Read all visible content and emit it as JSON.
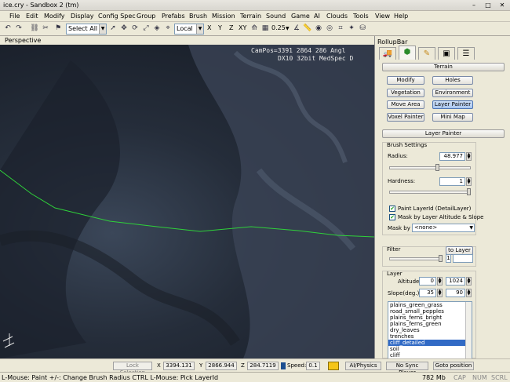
{
  "window": {
    "title": "ice.cry - Sandbox 2 (tm)"
  },
  "menu": [
    "File",
    "Edit",
    "Modify",
    "Display",
    "Config Spec",
    "Group",
    "Prefabs",
    "Brush",
    "Mission",
    "Terrain",
    "Sound",
    "Game",
    "AI",
    "Clouds",
    "Tools",
    "View",
    "Help"
  ],
  "toolbar": {
    "selection_filter": "Select All",
    "coord_system": "Local",
    "axes": [
      "X",
      "Y",
      "Z",
      "XY"
    ],
    "snap_value": "0.25"
  },
  "viewport": {
    "title": "Perspective",
    "hud_line1": "CamPos=3391 2864 286 Angl",
    "hud_line2": "DX10 32bit MedSpec D"
  },
  "rollup": {
    "title": "RollupBar",
    "terrain_header": "Terrain",
    "terrain_buttons": [
      "Modify",
      "Holes",
      "Vegetation",
      "Environment",
      "Move Area",
      "Layer Painter",
      "Voxel Painter",
      "Mini Map"
    ],
    "active_button": "Layer Painter",
    "layer_painter_header": "Layer Painter",
    "brush_settings": {
      "title": "Brush Settings",
      "radius_label": "Radius:",
      "radius_value": "48.977",
      "hardness_label": "Hardness:",
      "hardness_value": "1",
      "paint_layer_label": "Paint LayerId (DetailLayer)",
      "mask_label": "Mask by Layer Altitude & Slope",
      "mask_by_label": "Mask by",
      "mask_by_value": "<none>"
    },
    "filter": {
      "title": "Filter",
      "to_layer": "to Layer",
      "value": "1"
    },
    "layer": {
      "title": "Layer",
      "altitude_label": "Altitude",
      "altitude_min": "0",
      "altitude_max": "1024",
      "slope_label": "Slope(deg.)",
      "slope_min": "35",
      "slope_max": "90",
      "items": [
        "plains_green_grass",
        "road_small_pepples",
        "plains_ferns_bright",
        "plains_ferns_green",
        "dry_leaves",
        "trenches",
        "cliff_detailed",
        "soil",
        "cliff"
      ],
      "selected": "cliff_detailed"
    }
  },
  "bottombar": {
    "lock_selection": "Lock Selection",
    "x_label": "X",
    "x_value": "3394.131",
    "y_label": "Y",
    "y_value": "2866.944",
    "z_label": "Z",
    "z_value": "284.7119",
    "speed_label": "Speed:",
    "speed_value": "0.1",
    "ai_physics": "AI/Physics",
    "no_sync": "No Sync Player",
    "goto": "Goto position"
  },
  "statusbar": {
    "hint": "L-Mouse: Paint  +/-: Change Brush Radius   CTRL L-Mouse: Pick LayerId",
    "memory": "782 Mb",
    "indicators": [
      "CAP",
      "NUM",
      "SCRL"
    ]
  },
  "colors": {
    "accent": "#316ac5",
    "terrain_line": "#2fd13a"
  }
}
